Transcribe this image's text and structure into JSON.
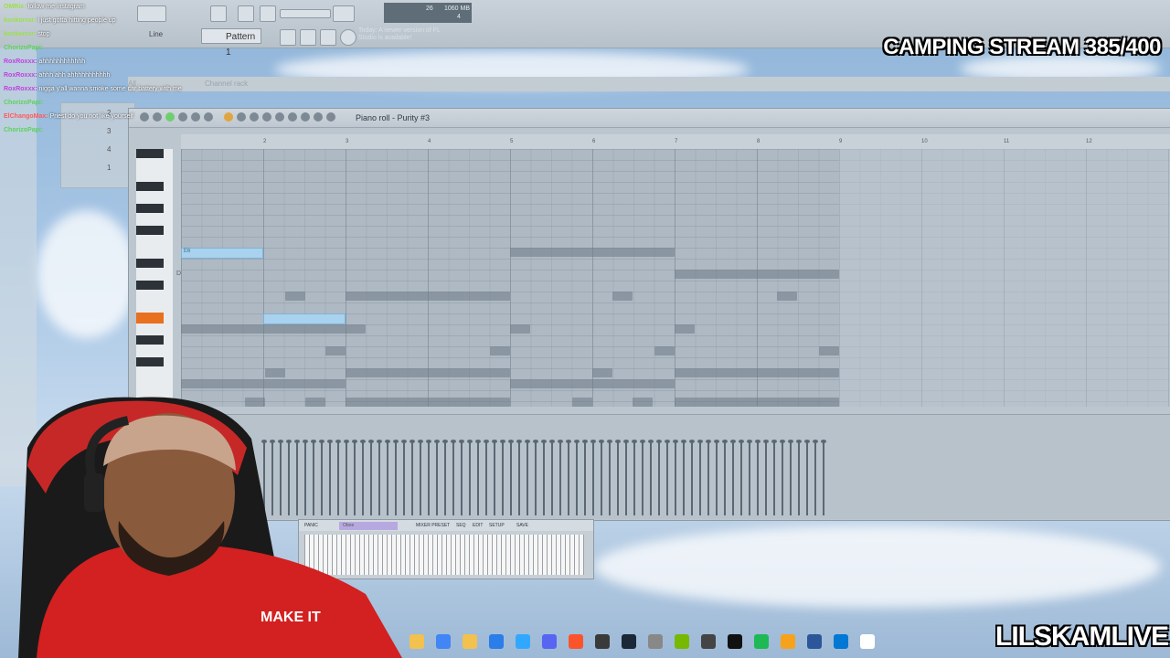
{
  "overlay": {
    "stream_title": "CAMPING STREAM 385/400",
    "channel_name": "LILSKAMLIVE"
  },
  "chat": [
    {
      "user": "OMRix",
      "user_color": "#9be04a",
      "text": "follow me instagram"
    },
    {
      "user": "konkorror",
      "user_color": "#9be04a",
      "text": "i just gotta hitting people up"
    },
    {
      "user": "konkorror",
      "user_color": "#9be04a",
      "text": "stop"
    },
    {
      "user": "ChorizoPapi",
      "user_color": "#5bd35b",
      "text": ""
    },
    {
      "user": "RoxRoxxx",
      "user_color": "#c040e0",
      "text": "ahhhhhhhhhhhh"
    },
    {
      "user": "RoxRoxxx",
      "user_color": "#c040e0",
      "text": "ahhh ahh ahhhhhhhhhhh"
    },
    {
      "user": "RoxRoxxx",
      "user_color": "#c040e0",
      "text": "nigga y'all wanna smoke some car battery with me"
    },
    {
      "user": "ChorizoPapi",
      "user_color": "#5bd35b",
      "text": ""
    },
    {
      "user": "ElChangoMax",
      "user_color": "#ff5a5a",
      "text": "Priest do you not like yourself"
    },
    {
      "user": "ChorizoPapi",
      "user_color": "#5bd35b",
      "text": ""
    }
  ],
  "toolbar": {
    "pattern_label": "Pattern 1",
    "snap_label": "Line",
    "hint_text": "Today: A newer version of FL Studio is available!",
    "cpu_value": "26",
    "ram_value": "1060 MB",
    "poly_value": "4"
  },
  "channel_rack": {
    "title": "Channel rack",
    "filter": "All",
    "numbers": [
      "2",
      "3",
      "4",
      "1"
    ]
  },
  "piano_roll": {
    "title": "Piano roll - Purity #3",
    "bar_numbers": [
      "2",
      "3",
      "4",
      "5",
      "6",
      "7",
      "8",
      "9",
      "10",
      "11",
      "12"
    ],
    "key_label": "D6",
    "selected_note_label": "E6",
    "accent_key_color": "#e8701f"
  },
  "mini_piano": {
    "instrument": "Oboe",
    "buttons": [
      "PANIC",
      "MIXER PRESET",
      "SEQ",
      "EDIT",
      "SETUP",
      "SAVE"
    ]
  },
  "taskbar": {
    "icons": [
      "folder-icon",
      "chrome-icon",
      "explorer-icon",
      "store-icon",
      "photoshop-icon",
      "discord-icon",
      "brave-icon",
      "obs-icon",
      "steam-icon",
      "app-icon",
      "nvidia-icon",
      "4k-icon",
      "capcut-icon",
      "spotify-icon",
      "fl-studio-icon",
      "calculator-icon",
      "app2-icon",
      "notepad-icon"
    ]
  }
}
